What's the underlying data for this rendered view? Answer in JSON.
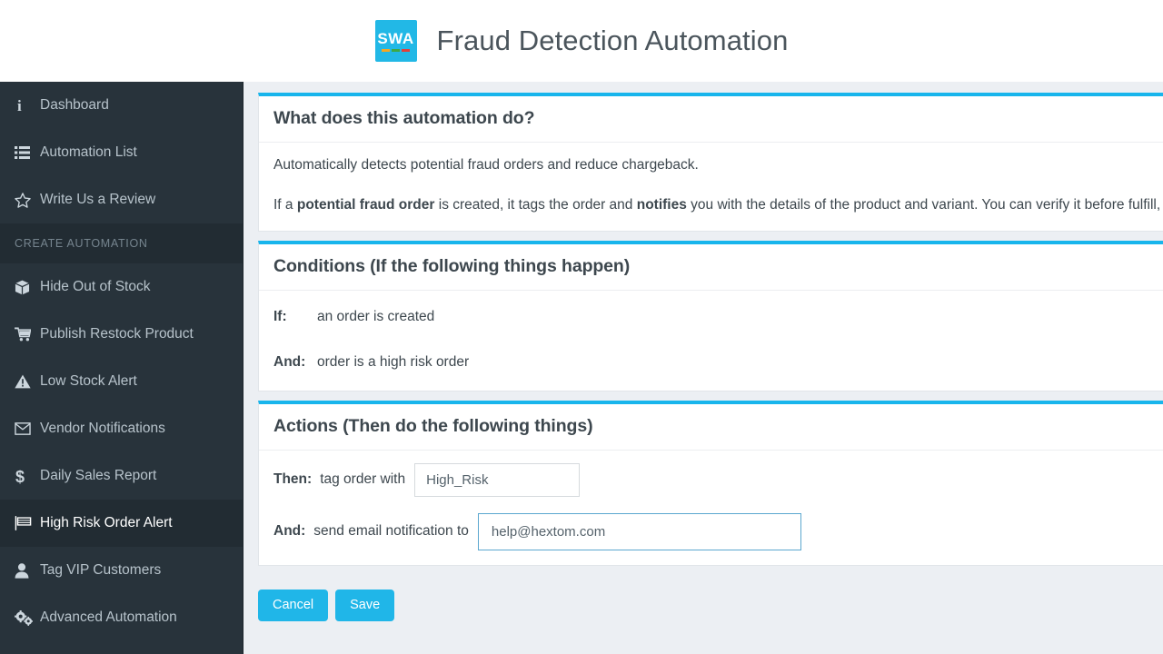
{
  "header": {
    "logo_text": "SWA",
    "logo_bg": "#22b8e6",
    "logo_bar_colors": [
      "#f5a623",
      "#3fa845",
      "#e2403a"
    ],
    "title": "Fraud Detection Automation"
  },
  "sidebar": {
    "items": [
      {
        "label": "Dashboard",
        "icon": "info-icon",
        "active": false
      },
      {
        "label": "Automation List",
        "icon": "list-icon",
        "active": false
      },
      {
        "label": "Write Us a Review",
        "icon": "star-icon",
        "active": false
      }
    ],
    "section_label": "CREATE AUTOMATION",
    "automation_items": [
      {
        "label": "Hide Out of Stock",
        "icon": "box-icon",
        "active": false
      },
      {
        "label": "Publish Restock Product",
        "icon": "cart-icon",
        "active": false
      },
      {
        "label": "Low Stock Alert",
        "icon": "warning-icon",
        "active": false
      },
      {
        "label": "Vendor Notifications",
        "icon": "envelope-icon",
        "active": false
      },
      {
        "label": "Daily Sales Report",
        "icon": "dollar-icon",
        "active": false
      },
      {
        "label": "High Risk Order Alert",
        "icon": "flag-icon",
        "active": true
      },
      {
        "label": "Tag VIP Customers",
        "icon": "user-icon",
        "active": false
      },
      {
        "label": "Advanced Automation",
        "icon": "cogs-icon",
        "active": false
      }
    ]
  },
  "about_card": {
    "title": "What does this automation do?",
    "paragraph_1": "Automatically detects potential fraud orders and reduce chargeback.",
    "p2_part1": "If a ",
    "p2_bold1": "potential fraud order",
    "p2_part2": " is created, it tags the order and ",
    "p2_bold2": "notifies",
    "p2_part3": " you with the details of the product and variant. You can verify it before fulfill, chargeback."
  },
  "conditions_card": {
    "title": "Conditions (If the following things happen)",
    "rows": [
      {
        "label": "If:",
        "text": "an order is created"
      },
      {
        "label": "And:",
        "text": "order is a high risk order"
      }
    ]
  },
  "actions_card": {
    "title": "Actions (Then do the following things)",
    "then_label": "Then:",
    "then_text": "tag order with",
    "tag_value": "High_Risk",
    "tag_placeholder": "Tag",
    "and_label": "And:",
    "and_text": "send email notification to",
    "email_value": "help@hextom.com",
    "email_placeholder": "Email address"
  },
  "footer": {
    "cancel_label": "Cancel",
    "save_label": "Save",
    "button_color": "#20b6e8"
  },
  "theme": {
    "accent": "#18b5ec",
    "sidebar_bg": "#28333b",
    "page_bg": "#eceff3"
  }
}
